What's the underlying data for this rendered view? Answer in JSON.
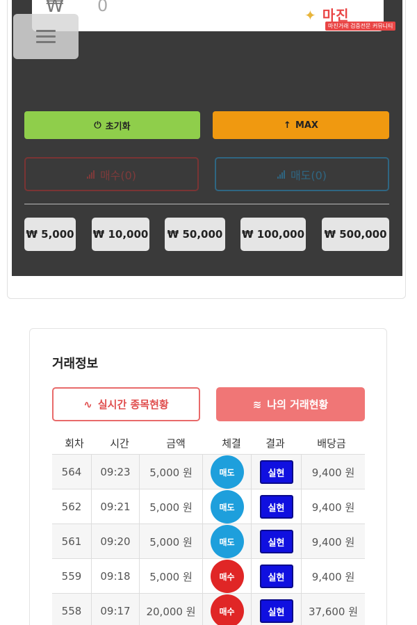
{
  "input": {
    "currency": "₩",
    "value": "0"
  },
  "watermark": {
    "logo": "마진",
    "tagline": "마진거래 검증전문 커뮤니티"
  },
  "controls": {
    "reset_label": "초기화",
    "max_label": "MAX",
    "buy_label": "매수(0)",
    "sell_label": "매도(0)"
  },
  "amount_chips": [
    "₩ 5,000",
    "₩ 10,000",
    "₩ 50,000",
    "₩ 100,000",
    "₩ 500,000"
  ],
  "trade_info": {
    "title": "거래정보",
    "tab_live": "실시간 종목현황",
    "tab_mine": "나의 거래현황",
    "columns": [
      "회차",
      "시간",
      "금액",
      "체결",
      "결과",
      "배당금"
    ],
    "rows": [
      {
        "round": "564",
        "time": "09:23",
        "amount": "5,000 원",
        "exec": "매도",
        "result": "실현",
        "payout": "9,400 원"
      },
      {
        "round": "562",
        "time": "09:21",
        "amount": "5,000 원",
        "exec": "매도",
        "result": "실현",
        "payout": "9,400 원"
      },
      {
        "round": "561",
        "time": "09:20",
        "amount": "5,000 원",
        "exec": "매도",
        "result": "실현",
        "payout": "9,400 원"
      },
      {
        "round": "559",
        "time": "09:18",
        "amount": "5,000 원",
        "exec": "매수",
        "result": "실현",
        "payout": "9,400 원"
      },
      {
        "round": "558",
        "time": "09:17",
        "amount": "20,000 원",
        "exec": "매수",
        "result": "실현",
        "payout": "37,600 원"
      }
    ]
  },
  "colors": {
    "buy": "#e02626",
    "sell": "#1e9fdc",
    "result": "#1010e0",
    "reset": "#8fce4b",
    "max": "#f09910"
  }
}
